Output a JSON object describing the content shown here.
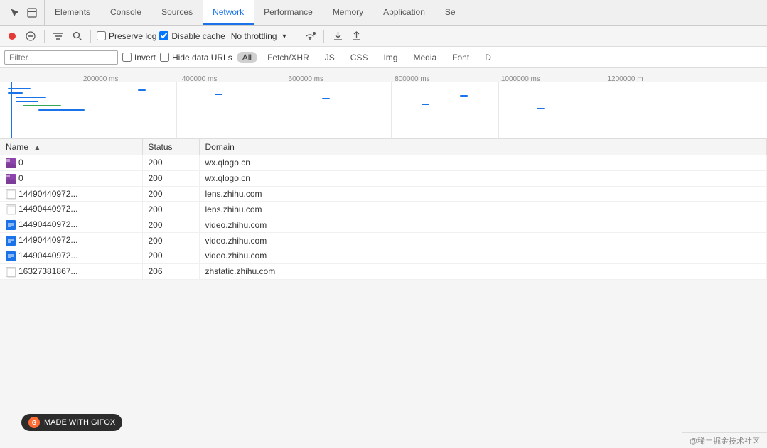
{
  "tabs": {
    "icons": [
      "cursor",
      "layout"
    ],
    "items": [
      {
        "label": "Elements",
        "active": false
      },
      {
        "label": "Console",
        "active": false
      },
      {
        "label": "Sources",
        "active": false
      },
      {
        "label": "Network",
        "active": true
      },
      {
        "label": "Performance",
        "active": false
      },
      {
        "label": "Memory",
        "active": false
      },
      {
        "label": "Application",
        "active": false
      },
      {
        "label": "Se",
        "active": false
      }
    ]
  },
  "toolbar": {
    "record_btn": "●",
    "clear_btn": "🚫",
    "filter_btn": "▼",
    "search_btn": "🔍",
    "preserve_log_label": "Preserve log",
    "disable_cache_label": "Disable cache",
    "disable_cache_checked": true,
    "preserve_log_checked": false,
    "no_throttling_label": "No throttling",
    "wifi_icon": "📶",
    "upload_icon": "⬆",
    "download_icon": "⬇"
  },
  "filter_bar": {
    "placeholder": "Filter",
    "invert_label": "Invert",
    "hide_data_urls_label": "Hide data URLs",
    "types": [
      {
        "label": "All",
        "active": true
      },
      {
        "label": "Fetch/XHR",
        "active": false
      },
      {
        "label": "JS",
        "active": false
      },
      {
        "label": "CSS",
        "active": false
      },
      {
        "label": "Img",
        "active": false
      },
      {
        "label": "Media",
        "active": false
      },
      {
        "label": "Font",
        "active": false
      },
      {
        "label": "D",
        "active": false
      }
    ]
  },
  "ruler": {
    "marks": [
      {
        "label": "200000 ms",
        "pos": "10%"
      },
      {
        "label": "400000 ms",
        "pos": "23%"
      },
      {
        "label": "600000 ms",
        "pos": "37%"
      },
      {
        "label": "800000 ms",
        "pos": "51%"
      },
      {
        "label": "1000000 ms",
        "pos": "65%"
      },
      {
        "label": "1200000 m",
        "pos": "79%"
      }
    ]
  },
  "table": {
    "columns": [
      {
        "label": "Name",
        "sort": true
      },
      {
        "label": "Status"
      },
      {
        "label": "Domain"
      }
    ],
    "rows": [
      {
        "icon": "img",
        "name": "0",
        "status": "200",
        "domain": "wx.qlogo.cn"
      },
      {
        "icon": "img",
        "name": "0",
        "status": "200",
        "domain": "wx.qlogo.cn"
      },
      {
        "icon": "empty",
        "name": "14490440972...",
        "status": "200",
        "domain": "lens.zhihu.com"
      },
      {
        "icon": "empty",
        "name": "14490440972...",
        "status": "200",
        "domain": "lens.zhihu.com"
      },
      {
        "icon": "doc",
        "name": "14490440972...",
        "status": "200",
        "domain": "video.zhihu.com"
      },
      {
        "icon": "doc",
        "name": "14490440972...",
        "status": "200",
        "domain": "video.zhihu.com"
      },
      {
        "icon": "doc",
        "name": "14490440972...",
        "status": "200",
        "domain": "video.zhihu.com"
      },
      {
        "icon": "empty",
        "name": "16327381867...",
        "status": "206",
        "domain": "zhstatic.zhihu.com"
      }
    ]
  },
  "status_bar": {
    "text": "@稀土掘金技术社区"
  },
  "gifox": {
    "label": "MADE WITH GIFOX"
  }
}
